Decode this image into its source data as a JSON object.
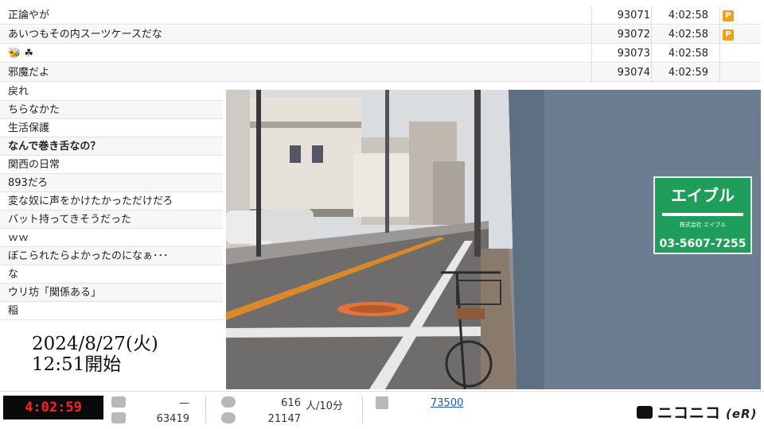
{
  "comments": [
    {
      "text": "正論やが",
      "number": "93071",
      "time": "4:02:58",
      "premium": "P"
    },
    {
      "text": "あいつもその内スーツケースだな",
      "number": "93072",
      "time": "4:02:58",
      "premium": "P"
    },
    {
      "text": "🐝 ☘",
      "number": "93073",
      "time": "4:02:58",
      "premium": ""
    },
    {
      "text": "邪魔だよ",
      "number": "93074",
      "time": "4:02:59",
      "premium": ""
    }
  ],
  "comments_partial": [
    {
      "text": "戻れ"
    },
    {
      "text": "ちらなかた"
    },
    {
      "text": "生活保護"
    },
    {
      "text": "なんで巻き舌なの？",
      "bold": true
    },
    {
      "text": "関西の日常"
    },
    {
      "text": "893だろ"
    },
    {
      "text": "変な奴に声をかけたかっただけだろ"
    },
    {
      "text": "バット持ってきそうだった"
    },
    {
      "text": "ｗｗ"
    },
    {
      "text": "ぼこられたらよかったのになぁ･･･"
    },
    {
      "text": "な"
    },
    {
      "text": "ウリ坊「関係ある」"
    },
    {
      "text": "稲"
    }
  ],
  "stream_start": {
    "date": "2024/8/27(火)",
    "time": "12:51開始"
  },
  "video_sign": {
    "brand": "エイブル",
    "subtext": "株式会社 エイブル",
    "phone": "03-5607-7255"
  },
  "bottom_bar": {
    "elapsed": "4:02:59",
    "comments_per_10min": "—",
    "total_comments": "63419",
    "viewers_per_10min": "616",
    "viewers_unit": "人/10分",
    "total_viewers": "21147",
    "ad_points": "73500",
    "brand": "ニコニコ",
    "brand_suffix": "(eR)"
  },
  "colors": {
    "premium_badge": "#f0a018",
    "timer_text": "#ff2020",
    "link": "#1a55c8"
  }
}
